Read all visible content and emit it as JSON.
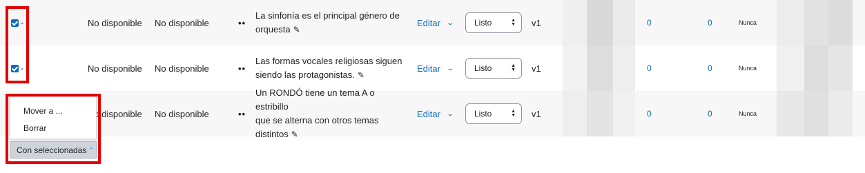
{
  "rows": [
    {
      "selected": true,
      "dash": "-",
      "availability1": "No disponible",
      "availability2": "No disponible",
      "drag_handle": "••",
      "question_line1": "La sinfonía es el principal género de",
      "question_line2": "orquesta",
      "question_line3": "",
      "edit_label": "Editar",
      "status_value": "Listo",
      "version": "v1",
      "stat1": "0",
      "stat2": "0",
      "last_used": "Nunca"
    },
    {
      "selected": true,
      "dash": "-",
      "availability1": "No disponible",
      "availability2": "No disponible",
      "drag_handle": "••",
      "question_line1": "Las formas vocales religiosas siguen",
      "question_line2": "siendo las protagonistas.",
      "question_line3": "",
      "edit_label": "Editar",
      "status_value": "Listo",
      "version": "v1",
      "stat1": "0",
      "stat2": "0",
      "last_used": "Nunca"
    },
    {
      "selected": false,
      "dash": "",
      "availability1": "No disponible",
      "availability2": "No disponible",
      "drag_handle": "••",
      "question_line1": "Un RONDÓ tiene un tema A o estribillo",
      "question_line2": "que se alterna con otros temas",
      "question_line3": "distintos",
      "edit_label": "Editar",
      "status_value": "Listo",
      "version": "v1",
      "stat1": "0",
      "stat2": "0",
      "last_used": "Nunca"
    }
  ],
  "bulk_menu": {
    "items": [
      "Mover a ...",
      "Borrar"
    ],
    "button_label": "Con seleccionadas"
  },
  "colors": {
    "accent": "#0f6cbf",
    "highlight": "#e30000",
    "row_alt": "#f7f7f7"
  },
  "icons": {
    "pencil": "pencil-icon",
    "chevron": "chevron-down-icon",
    "caret": "chevron-up-icon"
  }
}
